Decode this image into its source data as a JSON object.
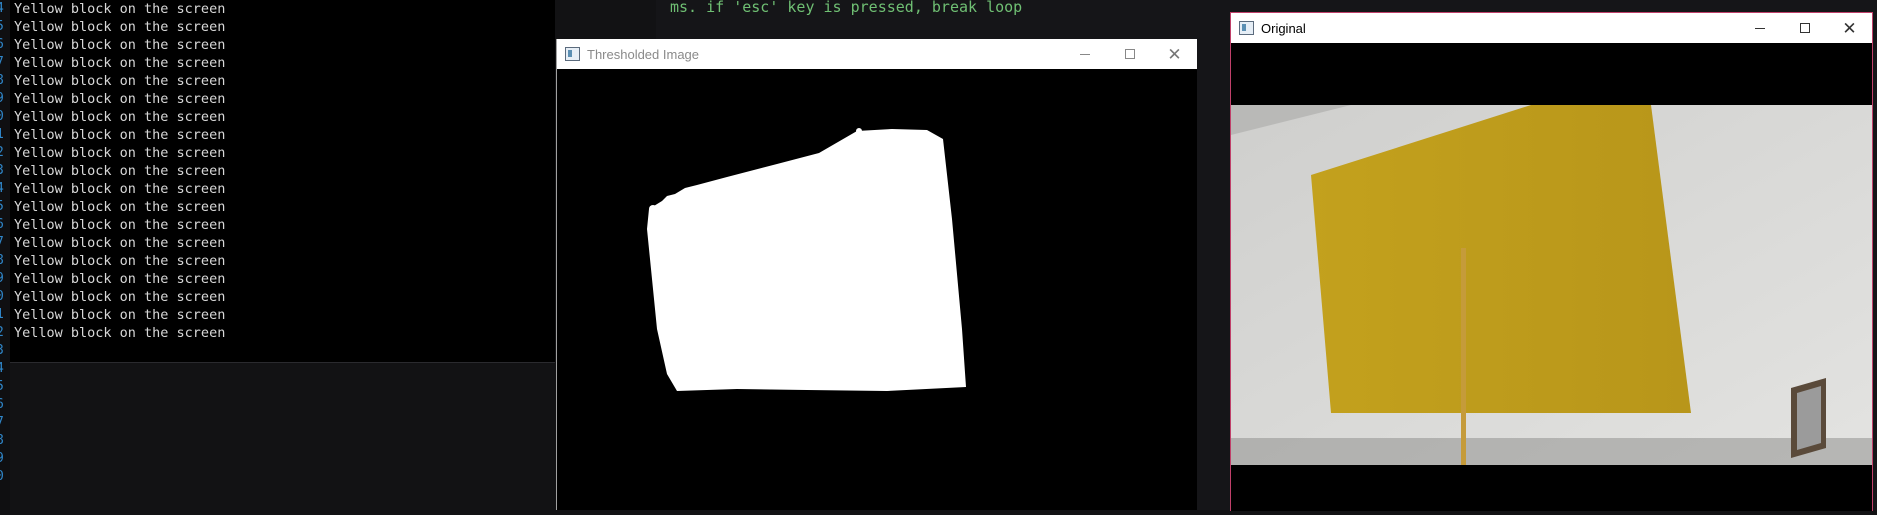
{
  "console": {
    "gutter_numbers": [
      "4",
      "5",
      "6",
      "7",
      "8",
      "9",
      "0",
      "1",
      "2",
      "3",
      "4",
      "5",
      "6",
      "7",
      "8",
      "9",
      "0",
      "1",
      "2",
      "3",
      "4",
      "5",
      "6",
      "7",
      "8",
      "9",
      "0"
    ],
    "lines": [
      "Yellow block on the screen",
      "Yellow block on the screen",
      "Yellow block on the screen",
      "Yellow block on the screen",
      "Yellow block on the screen",
      "Yellow block on the screen",
      "Yellow block on the screen",
      "Yellow block on the screen",
      "Yellow block on the screen",
      "Yellow block on the screen",
      "Yellow block on the screen",
      "Yellow block on the screen",
      "Yellow block on the screen",
      "Yellow block on the screen",
      "Yellow block on the screen",
      "Yellow block on the screen",
      "Yellow block on the screen",
      "Yellow block on the screen",
      "Yellow block on the screen"
    ]
  },
  "editor": {
    "code_line": "ms. if 'esc' key is pressed, break loop"
  },
  "windows": {
    "thresholded": {
      "title": "Thresholded Image"
    },
    "original": {
      "title": "Original"
    }
  },
  "colors": {
    "yellow_block": "#c9a619",
    "wall": "#d8d8d6",
    "code_green": "#6fbf73",
    "gutter_blue": "#2f86c9"
  }
}
